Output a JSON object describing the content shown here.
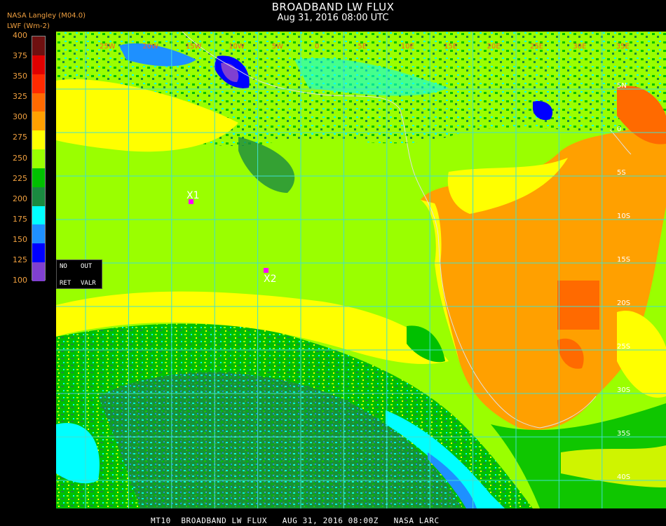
{
  "header": {
    "title": "BROADBAND LW FLUX",
    "datetime": "Aug 31, 2016 08:00 UTC",
    "source": "NASA Langley (M04.0)",
    "units": "LWF (Wm-2)"
  },
  "legend": {
    "ticks": [
      "400",
      "375",
      "350",
      "325",
      "300",
      "275",
      "250",
      "225",
      "200",
      "175",
      "150",
      "125",
      "100"
    ],
    "colors": [
      "#6e1010",
      "#e00000",
      "#ff2a00",
      "#ff6a00",
      "#ffa000",
      "#ffff00",
      "#9aff00",
      "#00c000",
      "#1a8a40",
      "#00ffff",
      "#1e90ff",
      "#0000ff",
      "#8040d0"
    ]
  },
  "map": {
    "lon_labels": [
      "25W",
      "20W",
      "15W",
      "10W",
      "5W",
      "0",
      "5E",
      "10E",
      "15E",
      "20E",
      "25E",
      "30E",
      "35E"
    ],
    "lat_labels": [
      "5N",
      "0",
      "5S",
      "10S",
      "15S",
      "20S",
      "25S",
      "30S",
      "35S",
      "40S"
    ],
    "markers": [
      {
        "label": "X1",
        "color": "#ff00ff"
      },
      {
        "label": "X2",
        "color": "#ff00ff"
      }
    ],
    "colors": {
      "ocean_green": "#9aff00",
      "cloud_yellow": "#ffff00",
      "land_orange": "#ffa000",
      "hot_orange": "#ff6a00",
      "grid": "#40e0d0"
    }
  },
  "controls": {
    "no": "NO",
    "out": "OUT",
    "ret": "RET",
    "valr": "VALR"
  },
  "footer": "MT10  BROADBAND LW FLUX   AUG 31, 2016 08:00Z   NASA LARC"
}
